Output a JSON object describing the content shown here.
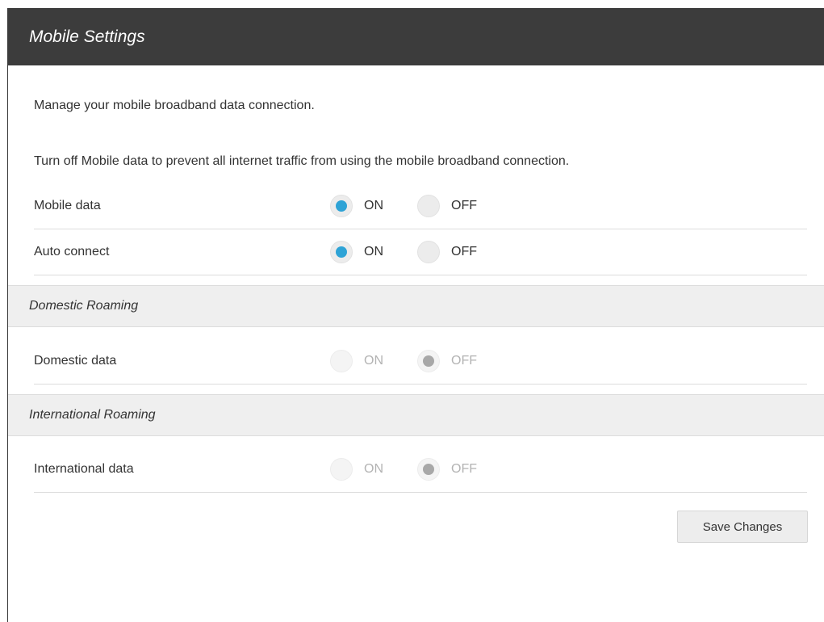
{
  "header": {
    "title": "Mobile Settings"
  },
  "intro": {
    "line1": "Manage your mobile broadband data connection.",
    "line2": "Turn off Mobile data to prevent all internet traffic from using the mobile broadband connection."
  },
  "rows": {
    "mobile_data": {
      "label": "Mobile data",
      "on_label": "ON",
      "off_label": "OFF",
      "selected": "ON",
      "enabled": true
    },
    "auto_connect": {
      "label": "Auto connect",
      "on_label": "ON",
      "off_label": "OFF",
      "selected": "ON",
      "enabled": true
    },
    "domestic_data": {
      "label": "Domestic data",
      "on_label": "ON",
      "off_label": "OFF",
      "selected": "OFF",
      "enabled": false
    },
    "international_data": {
      "label": "International data",
      "on_label": "ON",
      "off_label": "OFF",
      "selected": "OFF",
      "enabled": false
    }
  },
  "sections": {
    "domestic": "Domestic Roaming",
    "international": "International Roaming"
  },
  "actions": {
    "save_label": "Save Changes"
  },
  "colors": {
    "header_bg": "#3c3c3c",
    "accent": "#2ea3d6",
    "section_bg": "#efefef"
  }
}
